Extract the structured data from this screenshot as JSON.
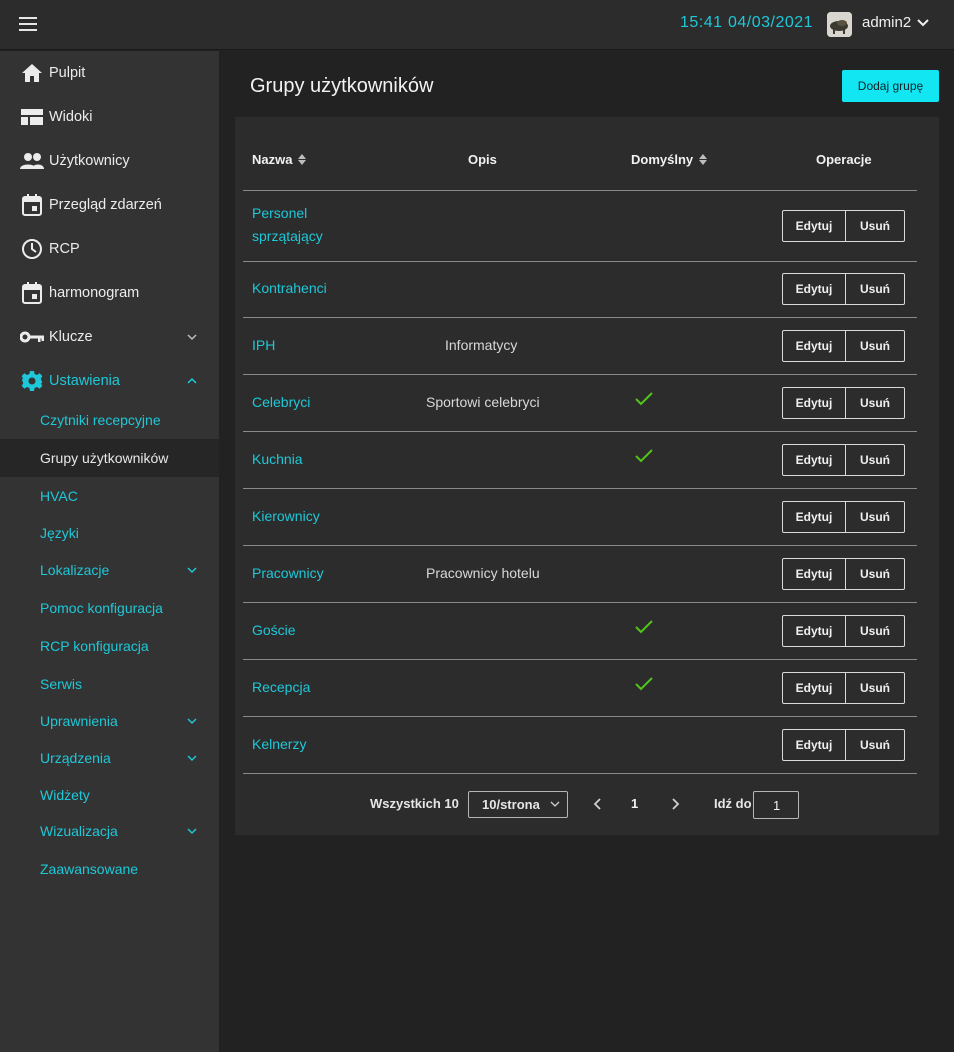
{
  "header": {
    "time": "15:41",
    "date": "04/03/2021",
    "username": "admin2"
  },
  "sidebar": {
    "items": [
      {
        "label": "Pulpit",
        "icon": "home-icon"
      },
      {
        "label": "Widoki",
        "icon": "view-icon"
      },
      {
        "label": "Użytkownicy",
        "icon": "users-icon"
      },
      {
        "label": "Przegląd zdarzeń",
        "icon": "calendar-icon"
      },
      {
        "label": "RCP",
        "icon": "clock-icon"
      },
      {
        "label": "harmonogram",
        "icon": "calendar-icon"
      },
      {
        "label": "Klucze",
        "icon": "key-icon"
      },
      {
        "label": "Ustawienia",
        "icon": "gear-icon"
      }
    ],
    "subitems": [
      {
        "label": "Czytniki recepcyjne"
      },
      {
        "label": "Grupy użytkowników"
      },
      {
        "label": "HVAC"
      },
      {
        "label": "Języki"
      },
      {
        "label": "Lokalizacje"
      },
      {
        "label": "Pomoc konfiguracja"
      },
      {
        "label": "RCP konfiguracja"
      },
      {
        "label": "Serwis"
      },
      {
        "label": "Uprawnienia"
      },
      {
        "label": "Urządzenia"
      },
      {
        "label": "Widżety"
      },
      {
        "label": "Wizualizacja"
      },
      {
        "label": "Zaawansowane"
      }
    ]
  },
  "main": {
    "title": "Grupy użytkowników",
    "add_label": "Dodaj grupę",
    "columns": {
      "name": "Nazwa",
      "desc": "Opis",
      "default": "Domyślny",
      "ops": "Operacje"
    },
    "edit_label": "Edytuj",
    "delete_label": "Usuń",
    "rows": [
      {
        "name": "Personel sprzątający",
        "desc": "",
        "default": false
      },
      {
        "name": "Kontrahenci",
        "desc": "",
        "default": false
      },
      {
        "name": "IPH",
        "desc": "Informatycy",
        "default": false
      },
      {
        "name": "Celebryci",
        "desc": "Sportowi celebryci",
        "default": true
      },
      {
        "name": "Kuchnia",
        "desc": "",
        "default": true
      },
      {
        "name": "Kierownicy",
        "desc": "",
        "default": false
      },
      {
        "name": "Pracownicy",
        "desc": "Pracownicy hotelu",
        "default": false
      },
      {
        "name": "Goście",
        "desc": "",
        "default": true
      },
      {
        "name": "Recepcja",
        "desc": "",
        "default": true
      },
      {
        "name": "Kelnerzy",
        "desc": "",
        "default": false
      }
    ]
  },
  "pagination": {
    "total": "Wszystkich 10",
    "page_size": "10/strona",
    "current_page": "1",
    "goto_label": "Idź do",
    "goto_value": "1"
  },
  "colors": {
    "accent": "#1ec8d8",
    "button": "#12e6f2",
    "check": "#52c41a"
  }
}
